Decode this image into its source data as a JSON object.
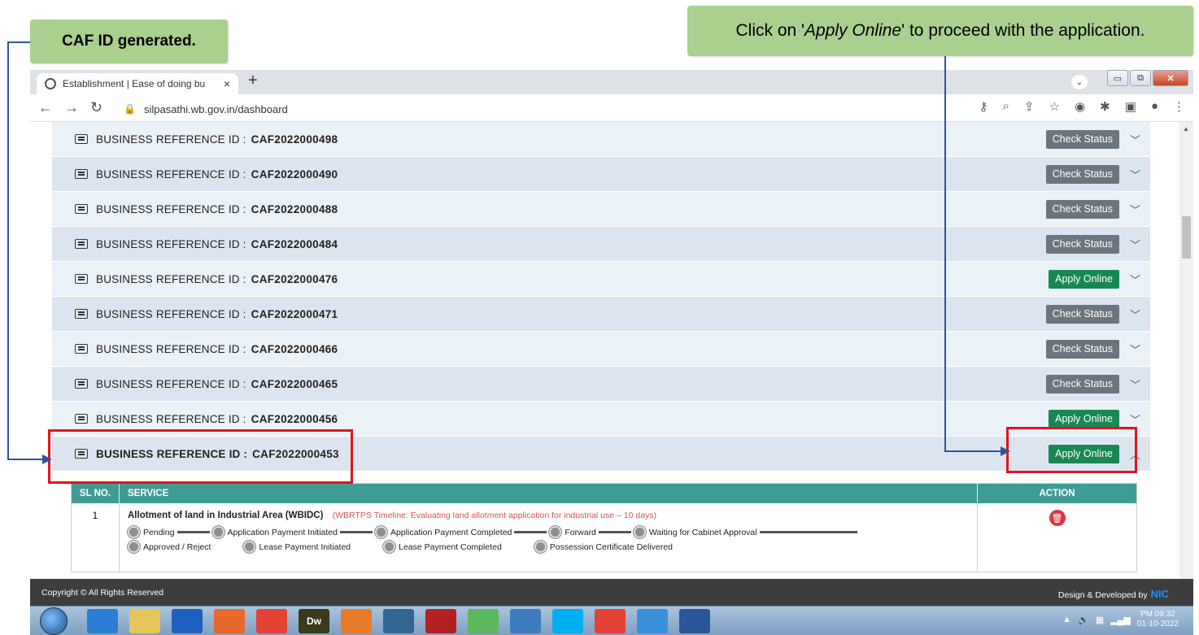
{
  "callouts": {
    "left": "CAF ID generated.",
    "right_before": "Click on '",
    "right_em": "Apply Online",
    "right_after": "' to proceed with the application."
  },
  "browser": {
    "tab_title": "Establishment | Ease of doing bu",
    "tab_close": "×",
    "new_tab": "+",
    "url": "silpasathi.wb.gov.in/dashboard",
    "controls": {
      "minimize": "▭",
      "maximize": "⧉",
      "close": "✕"
    }
  },
  "rows": [
    {
      "label": "BUSINESS REFERENCE ID :",
      "id": "CAF2022000498",
      "action": "Check Status",
      "type": "gray",
      "shade": "light"
    },
    {
      "label": "BUSINESS REFERENCE ID :",
      "id": "CAF2022000490",
      "action": "Check Status",
      "type": "gray",
      "shade": "blue"
    },
    {
      "label": "BUSINESS REFERENCE ID :",
      "id": "CAF2022000488",
      "action": "Check Status",
      "type": "gray",
      "shade": "light"
    },
    {
      "label": "BUSINESS REFERENCE ID :",
      "id": "CAF2022000484",
      "action": "Check Status",
      "type": "gray",
      "shade": "blue"
    },
    {
      "label": "BUSINESS REFERENCE ID :",
      "id": "CAF2022000476",
      "action": "Apply Online",
      "type": "green",
      "shade": "light"
    },
    {
      "label": "BUSINESS REFERENCE ID :",
      "id": "CAF2022000471",
      "action": "Check Status",
      "type": "gray",
      "shade": "blue"
    },
    {
      "label": "BUSINESS REFERENCE ID :",
      "id": "CAF2022000466",
      "action": "Check Status",
      "type": "gray",
      "shade": "light"
    },
    {
      "label": "BUSINESS REFERENCE ID :",
      "id": "CAF2022000465",
      "action": "Check Status",
      "type": "gray",
      "shade": "blue"
    },
    {
      "label": "BUSINESS REFERENCE ID :",
      "id": "CAF2022000456",
      "action": "Apply Online",
      "type": "green",
      "shade": "light"
    }
  ],
  "active_row": {
    "label": "BUSINESS REFERENCE ID :",
    "id": "CAF2022000453",
    "action": "Apply Online"
  },
  "service_table": {
    "headers": {
      "sl": "SL NO.",
      "service": "SERVICE",
      "action": "ACTION"
    },
    "row": {
      "sl": "1",
      "title": "Allotment of land in Industrial Area (WBIDC)",
      "timeline": "(WBRTPS Timeline: Evaluating land allotment application for industrial use – 10 days)",
      "steps_line1": [
        "Pending",
        "Application Payment Initiated",
        "Application Payment Completed",
        "Forward",
        "Waiting for Cabinet Approval"
      ],
      "steps_line2": [
        "Approved / Reject",
        "Lease Payment Initiated",
        "Lease Payment Completed",
        "Possession Certificate Delivered"
      ]
    }
  },
  "footer": {
    "copyright": "Copyright © All Rights Reserved",
    "design": "Design & Developed by",
    "logo": "NIC"
  },
  "taskbar": {
    "apps": [
      "ie-icon",
      "explorer-icon",
      "outlook-icon",
      "firefox-icon",
      "chrome-icon",
      "dreamweaver-icon",
      "xampp-icon",
      "postgres-icon",
      "filezilla-icon",
      "utorrent-icon",
      "python-icon",
      "skype-icon",
      "chrome-icon",
      "notepad-icon",
      "word-icon"
    ],
    "dw_label": "Dw",
    "time": "PM 09:32",
    "date": "01-10-2022"
  },
  "colors": {
    "callout": "#a9d08e",
    "gray_button": "#6c757d",
    "green_button": "#198754",
    "table_header": "#3f9c95",
    "annotation_red": "#e3141c",
    "annotation_blue": "#2f5597"
  }
}
